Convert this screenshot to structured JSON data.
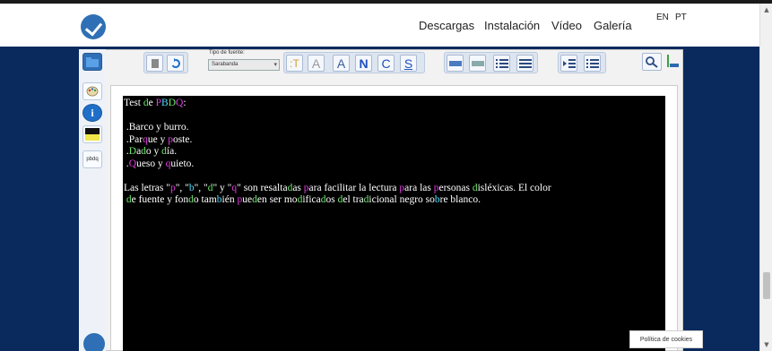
{
  "nav": {
    "links": [
      "Descargas",
      "Instalación",
      "Vídeo",
      "Galería"
    ],
    "langs": [
      "EN",
      "PT"
    ]
  },
  "toolbar": {
    "font_label": "Tipo de fuente:",
    "font_value": "Sarabanda",
    "format_buttons": [
      "N",
      "C",
      "S"
    ]
  },
  "sidebar": {
    "pbdq_label": "pbdq"
  },
  "editor": {
    "heading": [
      {
        "t": "Test ",
        "c": ""
      },
      {
        "t": "d",
        "c": "g"
      },
      {
        "t": "e ",
        "c": ""
      },
      {
        "t": "P",
        "c": "m"
      },
      {
        "t": "B",
        "c": "c"
      },
      {
        "t": "D",
        "c": "g"
      },
      {
        "t": "Q",
        "c": "m"
      },
      {
        "t": ":",
        "c": ""
      }
    ],
    "lines": [
      [
        {
          "t": " .Barco y burro.",
          "c": ""
        }
      ],
      [
        {
          "t": " .Par",
          "c": ""
        },
        {
          "t": "q",
          "c": "m"
        },
        {
          "t": "ue y ",
          "c": ""
        },
        {
          "t": "p",
          "c": "m"
        },
        {
          "t": "oste.",
          "c": ""
        }
      ],
      [
        {
          "t": " .",
          "c": ""
        },
        {
          "t": "D",
          "c": "g"
        },
        {
          "t": "a",
          "c": ""
        },
        {
          "t": "d",
          "c": "g"
        },
        {
          "t": "o y ",
          "c": ""
        },
        {
          "t": "d",
          "c": "g"
        },
        {
          "t": "ía.",
          "c": ""
        }
      ],
      [
        {
          "t": " .",
          "c": ""
        },
        {
          "t": "Q",
          "c": "m"
        },
        {
          "t": "ueso y ",
          "c": ""
        },
        {
          "t": "q",
          "c": "m"
        },
        {
          "t": "uieto.",
          "c": ""
        }
      ]
    ],
    "paragraph": [
      [
        {
          "t": "Las letras \"",
          "c": ""
        },
        {
          "t": "p",
          "c": "m"
        },
        {
          "t": "\", \"",
          "c": ""
        },
        {
          "t": "b",
          "c": "c"
        },
        {
          "t": "\", \"",
          "c": ""
        },
        {
          "t": "d",
          "c": "g"
        },
        {
          "t": "\" y \"",
          "c": ""
        },
        {
          "t": "q",
          "c": "m"
        },
        {
          "t": "\" son resalta",
          "c": ""
        },
        {
          "t": "d",
          "c": "g"
        },
        {
          "t": "as ",
          "c": ""
        },
        {
          "t": "p",
          "c": "m"
        },
        {
          "t": "ara facilitar la lectura ",
          "c": ""
        },
        {
          "t": "p",
          "c": "m"
        },
        {
          "t": "ara las ",
          "c": ""
        },
        {
          "t": "p",
          "c": "m"
        },
        {
          "t": "ersonas ",
          "c": ""
        },
        {
          "t": "d",
          "c": "g"
        },
        {
          "t": "isléxicas. El color",
          "c": ""
        }
      ],
      [
        {
          "t": " ",
          "c": ""
        },
        {
          "t": "d",
          "c": "g"
        },
        {
          "t": "e fuente y fon",
          "c": ""
        },
        {
          "t": "d",
          "c": "g"
        },
        {
          "t": "o tam",
          "c": ""
        },
        {
          "t": "b",
          "c": "c"
        },
        {
          "t": "ién ",
          "c": ""
        },
        {
          "t": "p",
          "c": "m"
        },
        {
          "t": "ue",
          "c": ""
        },
        {
          "t": "d",
          "c": "g"
        },
        {
          "t": "en ser mo",
          "c": ""
        },
        {
          "t": "d",
          "c": "g"
        },
        {
          "t": "ifica",
          "c": ""
        },
        {
          "t": "d",
          "c": "g"
        },
        {
          "t": "os ",
          "c": ""
        },
        {
          "t": "d",
          "c": "g"
        },
        {
          "t": "el tra",
          "c": ""
        },
        {
          "t": "d",
          "c": "g"
        },
        {
          "t": "icional negro so",
          "c": ""
        },
        {
          "t": "b",
          "c": "c"
        },
        {
          "t": "re blanco.",
          "c": ""
        }
      ]
    ]
  },
  "cookies": {
    "label": "Política de cookies"
  },
  "colors": {
    "header_bg": "#ffffff",
    "page_bg": "#0a2a5e",
    "editor_bg": "#000000",
    "letter_p_q": "#e040e0",
    "letter_b": "#4fe0ff",
    "letter_d": "#6ee86e"
  }
}
